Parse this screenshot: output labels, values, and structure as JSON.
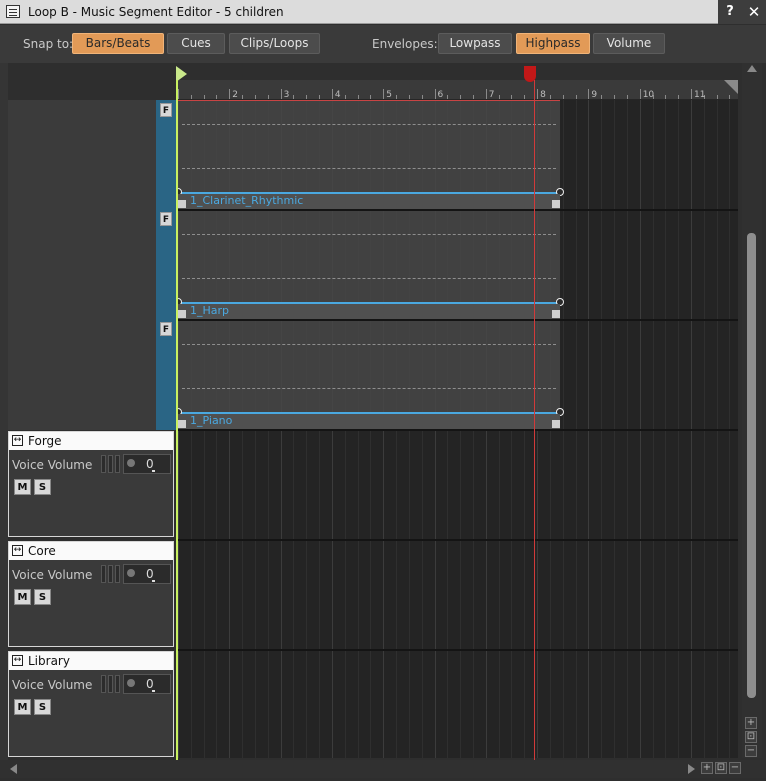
{
  "window": {
    "title": "Loop B - Music Segment Editor - 5 children",
    "help_label": "?",
    "close_label": "✕"
  },
  "toolbar": {
    "snap_label": "Snap to:",
    "snap_buttons": [
      {
        "label": "Bars/Beats",
        "active": true
      },
      {
        "label": "Cues",
        "active": false
      },
      {
        "label": "Clips/Loops",
        "active": false
      }
    ],
    "envelopes_label": "Envelopes:",
    "envelope_buttons": [
      {
        "label": "Lowpass",
        "active": false
      },
      {
        "label": "Highpass",
        "active": true
      },
      {
        "label": "Volume",
        "active": false
      }
    ]
  },
  "ruler": {
    "labels": [
      "2",
      "3",
      "4",
      "5",
      "6",
      "7",
      "8",
      "9",
      "10",
      "11"
    ]
  },
  "clips": [
    {
      "name": "1_Clarinet_Rhythmic",
      "flag": "F"
    },
    {
      "name": "1_Harp",
      "flag": "F"
    },
    {
      "name": "1_Piano",
      "flag": "F"
    }
  ],
  "tracks": [
    {
      "name": "Forge",
      "property": "Voice Volume",
      "value": "0",
      "mute": "M",
      "solo": "S",
      "expand": "↔"
    },
    {
      "name": "Core",
      "property": "Voice Volume",
      "value": "0",
      "mute": "M",
      "solo": "S",
      "expand": "↔"
    },
    {
      "name": "Library",
      "property": "Voice Volume",
      "value": "0",
      "mute": "M",
      "solo": "S",
      "expand": "↔"
    }
  ],
  "scroll": {
    "plus": "+",
    "fit": "⊡",
    "minus": "−"
  },
  "colors": {
    "accent": "#e29a57",
    "clip_name": "#4aa8e0",
    "playhead": "#c8f060",
    "end_marker": "#c21818"
  }
}
